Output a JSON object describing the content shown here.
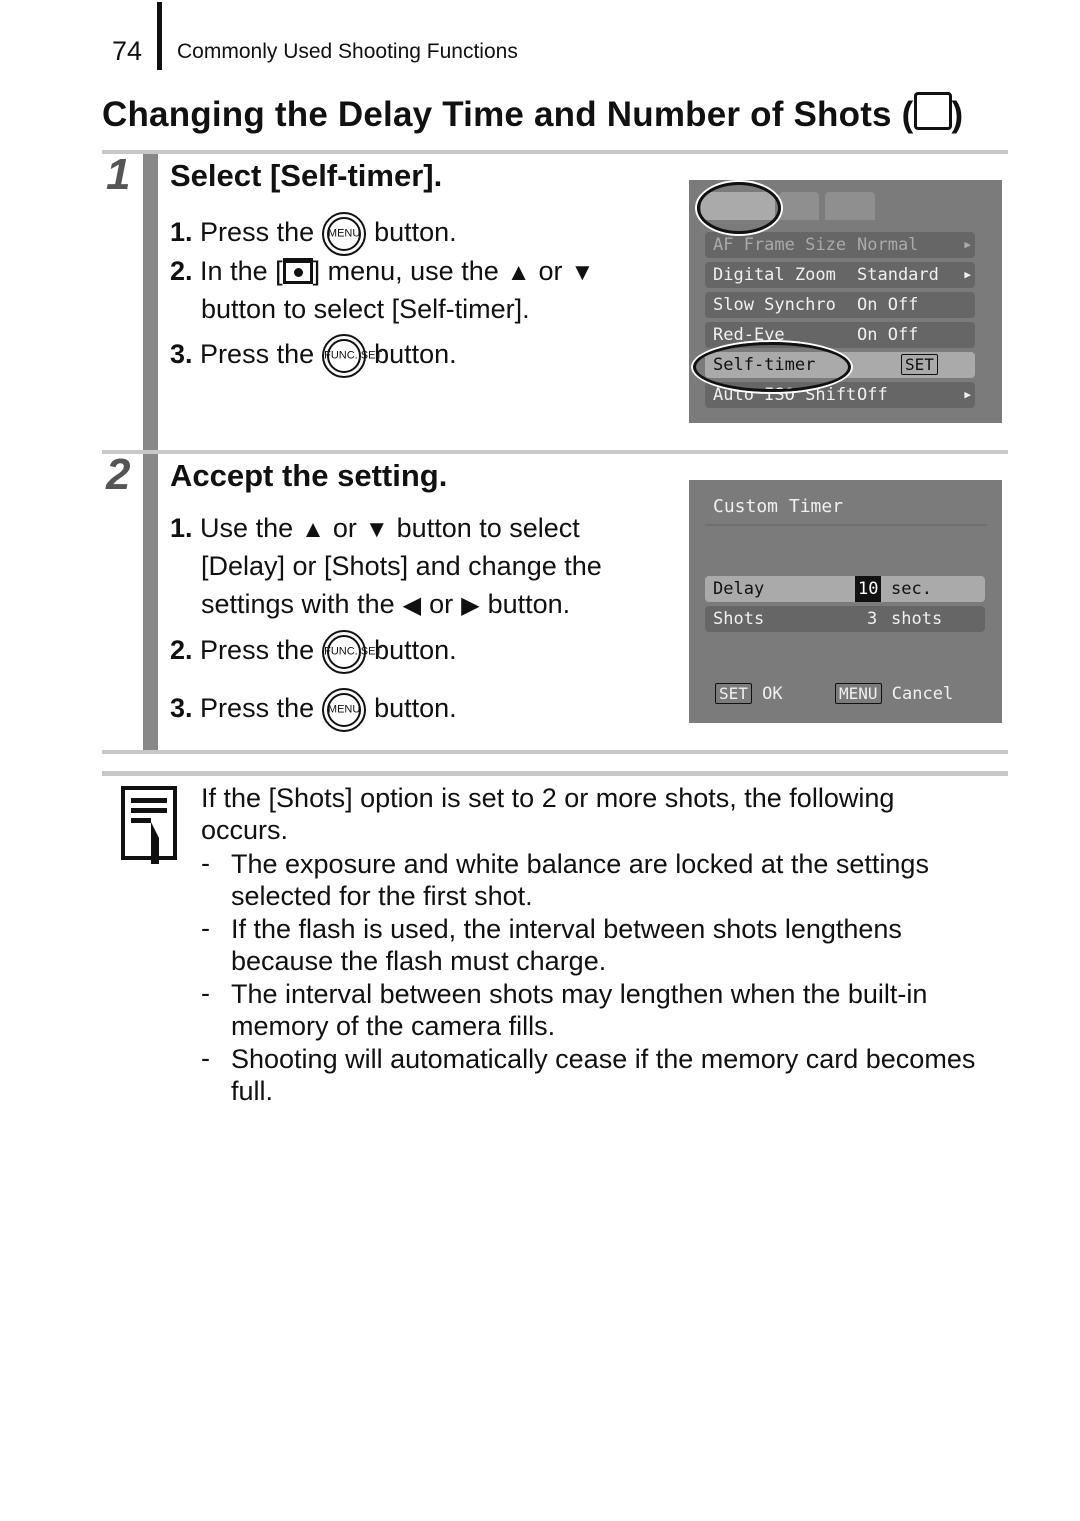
{
  "header": {
    "page_number": "74",
    "section": "Commonly Used Shooting Functions"
  },
  "title": "Changing the Delay Time and Number of Shots (",
  "title_end": ")",
  "step1": {
    "number": "1",
    "heading": "Select [Self-timer].",
    "items": [
      {
        "num": "1.",
        "pre": "Press the",
        "btn": "MENU",
        "post": "button."
      },
      {
        "num": "2.",
        "pre": "In the [",
        "mid": "] menu, use the",
        "or": "or",
        "line2": "button to select [Self-timer]."
      },
      {
        "num": "3.",
        "pre": "Press the",
        "btn": "FUNC. SET",
        "post": "button."
      }
    ],
    "screen": {
      "rows": [
        {
          "label": "AF Frame Size",
          "value": "Normal"
        },
        {
          "label": "Digital Zoom",
          "value": "Standard"
        },
        {
          "label": "Slow Synchro",
          "value": "On  Off"
        },
        {
          "label": "Red-Eye",
          "value": "On  Off"
        },
        {
          "label": "Self-timer",
          "value": "SET"
        },
        {
          "label": "Auto ISO Shift",
          "value": "Off"
        }
      ]
    }
  },
  "step2": {
    "number": "2",
    "heading": "Accept the setting.",
    "items": [
      {
        "num": "1.",
        "l1a": "Use the",
        "or": "or",
        "l1b": "button to select",
        "l2": "[Delay] or [Shots] and change the",
        "l3a": "settings with the",
        "l3b": "button."
      },
      {
        "num": "2.",
        "pre": "Press the",
        "btn": "FUNC. SET",
        "post": "button."
      },
      {
        "num": "3.",
        "pre": "Press the",
        "btn": "MENU",
        "post": "button."
      }
    ],
    "screen": {
      "title": "Custom Timer",
      "rows": [
        {
          "label": "Delay",
          "value": "10",
          "unit": "sec."
        },
        {
          "label": "Shots",
          "value": "3",
          "unit": "shots"
        }
      ],
      "ok_key": "SET",
      "ok_label": "OK",
      "cancel_key": "MENU",
      "cancel_label": "Cancel"
    }
  },
  "note": {
    "intro": "If the [Shots] option is set to 2 or more shots, the following occurs.",
    "bullets": [
      "The exposure and white balance are locked at the settings selected for the first shot.",
      "If the flash is used, the interval between shots lengthens because the flash must charge.",
      "The interval between shots may lengthen when the built-in memory of the camera fills.",
      "Shooting will automatically cease if the memory card becomes full."
    ]
  }
}
